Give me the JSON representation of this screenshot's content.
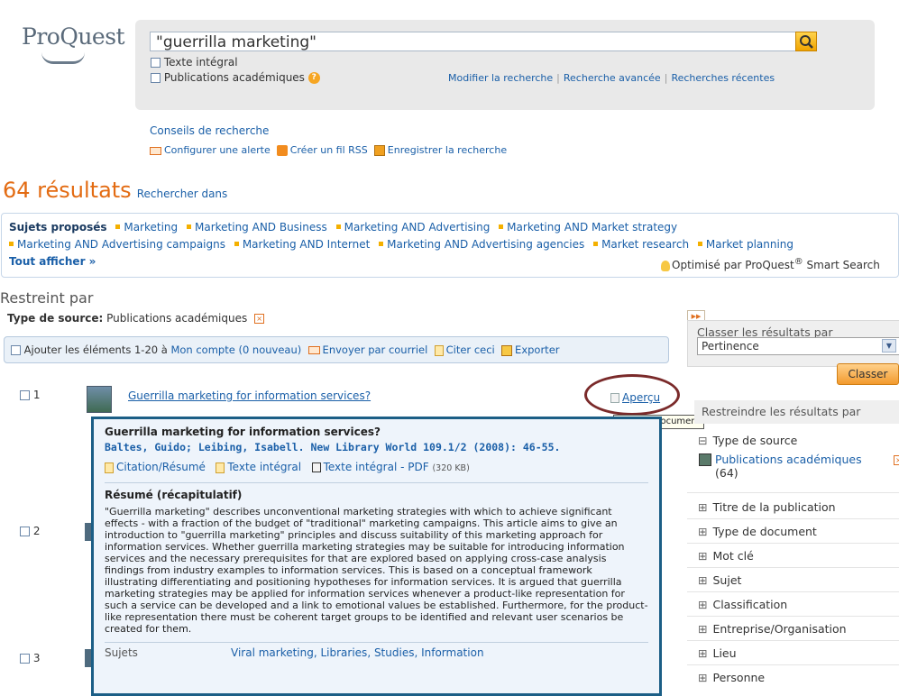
{
  "header": {
    "logo_text": "ProQuest",
    "search_value": "\"guerrilla marketing\"",
    "full_text_label": "Texte intégral",
    "scholarly_label": "Publications académiques",
    "help_glyph": "?",
    "link_modify": "Modifier la recherche",
    "link_advanced": "Recherche avancée",
    "link_recent": "Recherches récentes",
    "link_tips": "Conseils de recherche",
    "tool_alert": "Configurer une alerte",
    "tool_rss": "Créer un fil RSS",
    "tool_save": "Enregistrer la recherche"
  },
  "results": {
    "count_label": "64 résultats",
    "search_within": "Rechercher dans"
  },
  "subjects": {
    "heading": "Sujets proposés",
    "line1": [
      "Marketing",
      "Marketing AND Business",
      "Marketing AND Advertising",
      "Marketing AND Market strategy"
    ],
    "line2": [
      "Marketing AND Advertising campaigns",
      "Marketing AND Internet",
      "Marketing AND Advertising agencies",
      "Market research",
      "Market planning"
    ],
    "show_all": "Tout afficher »",
    "optimized_prefix": "Optimisé par ProQuest",
    "optimized_reg": "®",
    "optimized_suffix": " Smart Search"
  },
  "filter": {
    "heading": "Restreint par",
    "source_label": "Type de source:",
    "source_value": "Publications académiques",
    "remove_glyph": "×"
  },
  "actions": {
    "add_prefix": "Ajouter les éléments 1-20 à ",
    "add_account": "Mon compte (0 nouveau)",
    "email": "Envoyer par courriel",
    "cite": "Citer ceci",
    "export": "Exporter"
  },
  "items": [
    {
      "num": "1",
      "title": "Guerrilla marketing for information services?",
      "preview_label": "Aperçu"
    },
    {
      "num": "2"
    },
    {
      "num": "3"
    }
  ],
  "tooltip": "Preview document",
  "preview": {
    "title": "Guerrilla marketing for information services?",
    "authors": "Baltes, Guido; Leibing, Isabell. New Library World 109.1/2 (2008): 46-55.",
    "link_citation": "Citation/Résumé",
    "link_fulltext": "Texte intégral",
    "link_pdf": "Texte intégral - PDF",
    "pdf_size": "(320 KB)",
    "abstract_heading": "Résumé (récapitulatif)",
    "abstract": "\"Guerrilla marketing\" describes unconventional marketing strategies with which to achieve significant effects - with a fraction of the budget of \"traditional\" marketing campaigns. This article aims to give an introduction to \"guerrilla marketing\" principles and discuss suitability of this marketing approach for information services. Whether guerrilla marketing strategies may be suitable for introducing information services and the necessary prerequisites for that are explored based on applying cross-case analysis findings from industry examples to information services. This is based on a conceptual framework illustrating differentiating and positioning hypotheses for information services. It is argued that guerrilla marketing strategies may be applied for information services whenever a product-like representation for such a service can be developed and a link to emotional values be established. Furthermore, for the product-like representation there must be coherent target groups to be identified and relevant user scenarios be created for them.",
    "subjects_label": "Sujets",
    "subjects_value": "Viral marketing, Libraries, Studies, Information"
  },
  "sidebar": {
    "sort_heading": "Classer les résultats par",
    "sort_value": "Pertinence",
    "sort_button": "Classer",
    "refine_heading": "Restreindre les résultats par",
    "source_type": "Type de source",
    "source_option": "Publications académiques",
    "source_count": "(64)",
    "facets": [
      "Titre de la publication",
      "Type de document",
      "Mot clé",
      "Sujet",
      "Classification",
      "Entreprise/Organisation",
      "Lieu",
      "Personne"
    ],
    "expand_glyph": "⊞",
    "collapse_glyph": "⊟"
  }
}
